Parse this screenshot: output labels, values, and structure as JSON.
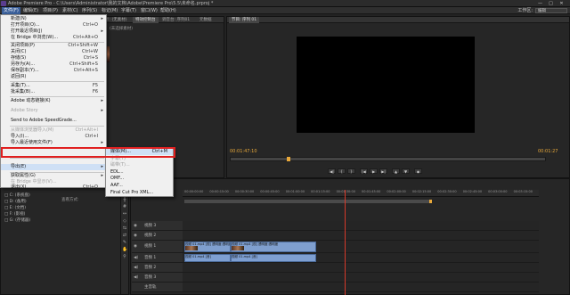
{
  "window": {
    "title": "Adobe Premiere Pro - C:\\Users\\Administrator\\我的文档\\Adobe\\Premiere Pro\\5.5\\未命名.prproj *",
    "controls": [
      "—",
      "□",
      "✕"
    ]
  },
  "menubar": {
    "items": [
      "文件(F)",
      "编辑(E)",
      "项目(P)",
      "素材(C)",
      "序列(S)",
      "标记(M)",
      "字幕(T)",
      "窗口(W)",
      "帮助(H)"
    ],
    "workspace_label": "工作区:",
    "workspace_value": "编辑"
  },
  "file_menu": {
    "items": [
      {
        "label": "新建(N)",
        "shortcut": "",
        "submenu": true,
        "disabled": false
      },
      {
        "label": "打开项目(O)...",
        "shortcut": "Ctrl+O",
        "submenu": false,
        "disabled": false
      },
      {
        "label": "打开最近项目(J)",
        "shortcut": "",
        "submenu": true,
        "disabled": false
      },
      {
        "label": "在 Bridge 中浏览(W)...",
        "shortcut": "Ctrl+Alt+O",
        "submenu": false,
        "disabled": false
      },
      {
        "label": "关闭项目(P)",
        "shortcut": "Ctrl+Shift+W",
        "submenu": false,
        "disabled": false
      },
      {
        "label": "关闭(C)",
        "shortcut": "Ctrl+W",
        "submenu": false,
        "disabled": false
      },
      {
        "label": "存储(S)",
        "shortcut": "Ctrl+S",
        "submenu": false,
        "disabled": false
      },
      {
        "label": "另存为(A)...",
        "shortcut": "Ctrl+Shift+S",
        "submenu": false,
        "disabled": false
      },
      {
        "label": "保存副本(Y)...",
        "shortcut": "Ctrl+Alt+S",
        "submenu": false,
        "disabled": false
      },
      {
        "label": "返回(R)",
        "shortcut": "",
        "submenu": false,
        "disabled": false
      },
      {
        "label": "采集(T)...",
        "shortcut": "F5",
        "submenu": false,
        "disabled": false
      },
      {
        "label": "批采集(B)...",
        "shortcut": "F6",
        "submenu": false,
        "disabled": false
      },
      {
        "label": "Adobe 动态链接(K)",
        "shortcut": "",
        "submenu": true,
        "disabled": false
      },
      {
        "label": "Adobe Story",
        "shortcut": "",
        "submenu": true,
        "disabled": true
      },
      {
        "label": "Send to Adobe SpeedGrade...",
        "shortcut": "",
        "submenu": false,
        "disabled": false
      },
      {
        "label": "从媒体浏览器导入(M)",
        "shortcut": "Ctrl+Alt+I",
        "submenu": false,
        "disabled": true
      },
      {
        "label": "导入(I)...",
        "shortcut": "Ctrl+I",
        "submenu": false,
        "disabled": false
      },
      {
        "label": "导入最近使用文件(F)",
        "shortcut": "",
        "submenu": true,
        "disabled": false
      },
      {
        "label": "导出(E)",
        "shortcut": "",
        "submenu": true,
        "disabled": false
      },
      {
        "label": "获取属性(G)",
        "shortcut": "",
        "submenu": true,
        "disabled": false
      },
      {
        "label": "在 Bridge 中显示(V)...",
        "shortcut": "",
        "submenu": false,
        "disabled": true
      },
      {
        "label": "退出(X)",
        "shortcut": "Ctrl+Q",
        "submenu": false,
        "disabled": false
      }
    ]
  },
  "export_submenu": {
    "items": [
      {
        "label": "媒体(M)...",
        "shortcut": "Ctrl+M",
        "disabled": false
      },
      {
        "label": "字幕(T)",
        "shortcut": "",
        "disabled": true
      },
      {
        "label": "磁带(T)...",
        "shortcut": "",
        "disabled": true
      },
      {
        "label": "EDL...",
        "shortcut": "",
        "disabled": false
      },
      {
        "label": "OMF...",
        "shortcut": "",
        "disabled": false
      },
      {
        "label": "AAF...",
        "shortcut": "",
        "disabled": false
      },
      {
        "label": "Final Cut Pro XML...",
        "shortcut": "",
        "disabled": false
      }
    ]
  },
  "source_panel": {
    "tabs": [
      "源: (无素材)",
      "特效控制台",
      "调音台: 序列01",
      "元数据"
    ],
    "placeholder": "(未选择素材)"
  },
  "program_monitor": {
    "tab": "节目: 序列 01",
    "timecode_current": "00:01:47:10",
    "timecode_duration": "00:01:27",
    "playhead_position": 0.18
  },
  "project_panel": {
    "tabs": [
      "项目: 未命名",
      "媒体浏览器",
      "信息",
      "效果",
      "历史"
    ],
    "search_placeholder": "查看方式:",
    "items": [
      "□ C: (系统盘)",
      "□ D: (备用)",
      "□ E: (文档)",
      "□ F: (影视)",
      "□ G: (存储器)"
    ]
  },
  "timeline": {
    "ruler_ticks": [
      "00:00:00:00",
      "00:00:15:00",
      "00:00:30:00",
      "00:00:45:00",
      "00:01:00:00",
      "00:01:15:00",
      "00:01:30:00",
      "00:01:45:00",
      "00:02:00:00",
      "00:02:15:00",
      "00:02:30:00",
      "00:02:45:00",
      "00:03:00:00",
      "00:03:15:00"
    ],
    "tracks": [
      "视频 3",
      "视频 2",
      "视频 1",
      "音频 1",
      "音频 2",
      "音频 3",
      "主音轨"
    ],
    "clips": {
      "video1_a": "视频 01.mp4 [视] 透明度:透明度",
      "video1_b": "视频 01.mp4 [视] 透明度:透明度",
      "audio1_a": "视频 01.mp4 [音]",
      "audio1_b": "视频 01.mp4 [音]"
    }
  }
}
